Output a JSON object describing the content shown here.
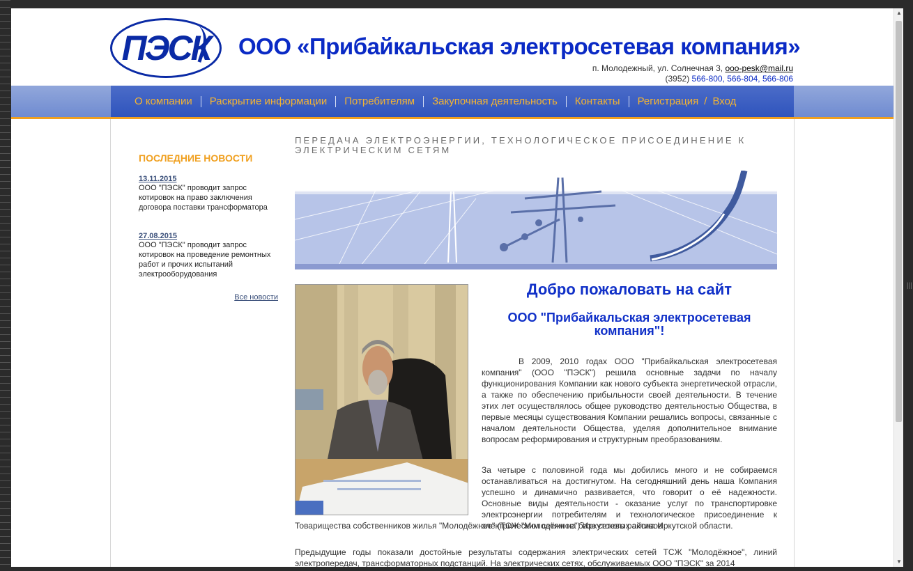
{
  "header": {
    "logo_text": "ПЭСК",
    "title": "ООО «Прибайкальская электросетевая компания»",
    "address": "п. Молодежный, ул. Солнечная 3, ",
    "email": "ooo-pesk@mail.ru",
    "phone_prefix": "(3952) ",
    "phones": "566-800, 566-804, 566-806"
  },
  "nav": {
    "items": [
      "О компании",
      "Раскрытие информации",
      "Потребителям",
      "Закупочная деятельность",
      "Контакты",
      "Регистрация",
      "Вход"
    ],
    "slash": "/"
  },
  "sidebar": {
    "title": "ПОСЛЕДНИЕ НОВОСТИ",
    "news": [
      {
        "date": "13.11.2015",
        "text": "ООО \"ПЭСК\" проводит запрос котировок на право заключения договора поставки трансформатора"
      },
      {
        "date": "27.08.2015",
        "text": "ООО \"ПЭСК\" проводит запрос котировок на проведение ремонтных работ и прочих испытаний электрооборудования"
      }
    ],
    "all_news": "Все новости"
  },
  "main": {
    "section_title": "ПЕРЕДАЧА ЭЛЕКТРОЭНЕРГИИ, ТЕХНОЛОГИЧЕСКОЕ ПРИСОЕДИНЕНИЕ К ЭЛЕКТРИЧЕСКИМ СЕТЯМ",
    "welcome": "Добро пожаловать на сайт",
    "company": "ООО \"Прибайкальская электросетевая компания\"!",
    "p1": "В 2009, 2010 годах ООО \"Прибайкальская электросетевая компания\" (ООО \"ПЭСК\") решила основные задачи по началу функционирования Компании как нового субъекта энергетической отрасли, а также по обеспечению прибыльности своей деятельности. В течение этих лет осуществлялось общее руководство деятельностью Общества, в первые месяцы существования Компании решались вопросы, связанные с началом деятельности Общества, уделяя дополнительное внимание вопросам реформирования и структурным преобразованиям.",
    "p2": "За четыре с половиной  года мы добились много и не собираемся останавливаться на достигнутом. На сегодняшний день наша Компания успешно и динамично развивается, что говорит о её надежности. Основные виды деятельности - оказание услуг по транспортировке электроэнергии потребителям и технологическое присоединение к электрическим сетям на базе сетевых активов",
    "p2b": "Товарищества собственников жилья \"Молодёжное\" (ТСЖ \"Молодёжное\") Иркутского района Иркутской области.",
    "p3": "Предыдущие годы показали достойные результаты содержания электрических сетей ТСЖ \"Молодёжное\", линий электропередач, трансформаторных подстанций. На электрических сетях, обслуживаемых ООО \"ПЭСК\" за 2014"
  },
  "colors": {
    "brand_blue": "#0a2ac5",
    "nav_text": "#f5b431",
    "accent_orange": "#f0a020"
  }
}
